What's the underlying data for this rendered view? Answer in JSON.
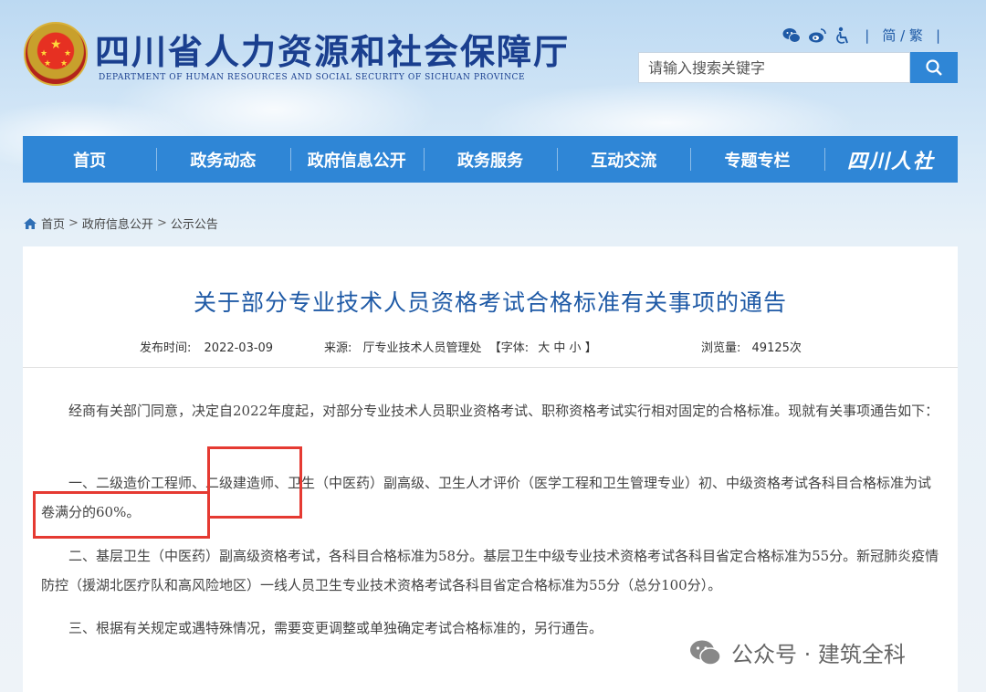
{
  "header": {
    "site_title": "四川省人力资源和社会保障厅",
    "site_subtitle": "DEPARTMENT OF HUMAN RESOURCES AND SOCIAL SECURITY OF SICHUAN PROVINCE",
    "lang_switch": "简 / 繁",
    "search_placeholder": "请输入搜索关键字",
    "icons": [
      "wechat-icon",
      "weibo-icon",
      "accessibility-icon",
      "search-icon"
    ]
  },
  "nav": {
    "items": [
      "首页",
      "政务动态",
      "政府信息公开",
      "政务服务",
      "互动交流",
      "专题专栏"
    ],
    "brand": "四川人社"
  },
  "breadcrumb": {
    "items": [
      "首页",
      "政府信息公开",
      "公示公告"
    ],
    "separator": ">"
  },
  "article": {
    "title": "关于部分专业技术人员资格考试合格标准有关事项的通告",
    "publish_label": "发布时间:",
    "publish_date": "2022-03-09",
    "source_label": "来源:",
    "source": "厅专业技术人员管理处",
    "font_label": "【字体:",
    "font_large": "大",
    "font_medium": "中",
    "font_small": "小",
    "font_close": "】",
    "views_label": "浏览量:",
    "views": "49125次",
    "paragraphs": [
      "经商有关部门同意，决定自2022年度起，对部分专业技术人员职业资格考试、职称资格考试实行相对固定的合格标准。现就有关事项通告如下：",
      "一、二级造价工程师、二级建造师、卫生（中医药）副高级、卫生人才评价（医学工程和卫生管理专业）初、中级资格考试各科目合格标准为试卷满分的60%。",
      "二、基层卫生（中医药）副高级资格考试，各科目合格标准为58分。基层卫生中级专业技术资格考试各科目省定合格标准为55分。新冠肺炎疫情防控（援湖北医疗队和高风险地区）一线人员卫生专业技术资格考试各科目省定合格标准为55分（总分100分）。",
      "三、根据有关规定或遇特殊情况，需要变更调整或单独确定考试合格标准的，另行通告。"
    ]
  },
  "watermark": {
    "text": "公众号 · 建筑全科"
  },
  "colors": {
    "nav_bg": "#2f86d6",
    "title_blue": "#1f5aa6",
    "highlight_red": "#e53a32"
  }
}
